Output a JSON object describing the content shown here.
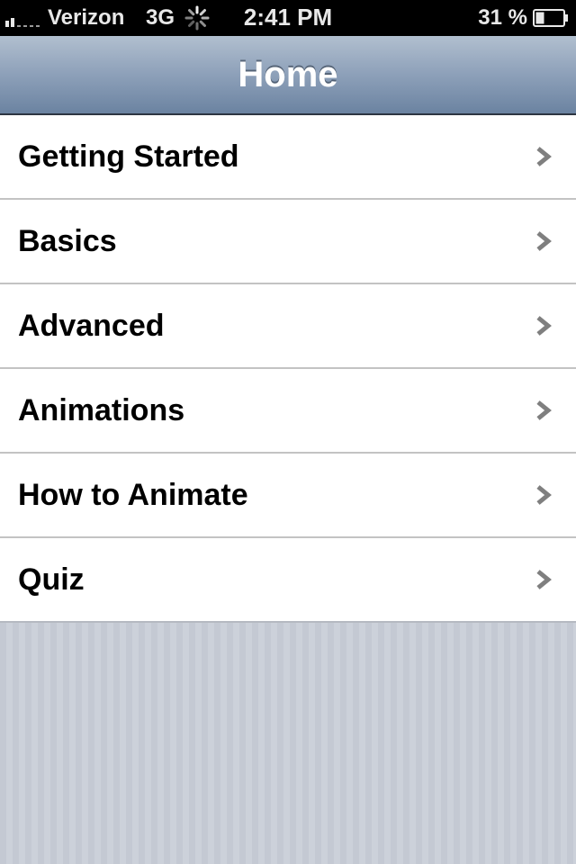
{
  "status_bar": {
    "carrier": "Verizon",
    "network": "3G",
    "time": "2:41 PM",
    "battery_percent": "31 %",
    "battery_level": 0.31,
    "signal_bars": 2,
    "icons": [
      "signal-strength-icon",
      "network-activity-spinner-icon",
      "battery-icon"
    ]
  },
  "nav_bar": {
    "title": "Home"
  },
  "menu": {
    "items": [
      {
        "label": "Getting Started",
        "icon": "chevron-right-icon"
      },
      {
        "label": "Basics",
        "icon": "chevron-right-icon"
      },
      {
        "label": "Advanced",
        "icon": "chevron-right-icon"
      },
      {
        "label": "Animations",
        "icon": "chevron-right-icon"
      },
      {
        "label": "How to Animate",
        "icon": "chevron-right-icon"
      },
      {
        "label": "Quiz",
        "icon": "chevron-right-icon"
      }
    ]
  },
  "colors": {
    "status_bar_bg": "#000000",
    "nav_bar_top": "#b1bfcf",
    "nav_bar_bottom": "#6b83a1",
    "cell_bg": "#ffffff",
    "separator": "#c3c3c3",
    "chevron": "#7f7f7f",
    "page_bg": "#c8cdd6"
  }
}
